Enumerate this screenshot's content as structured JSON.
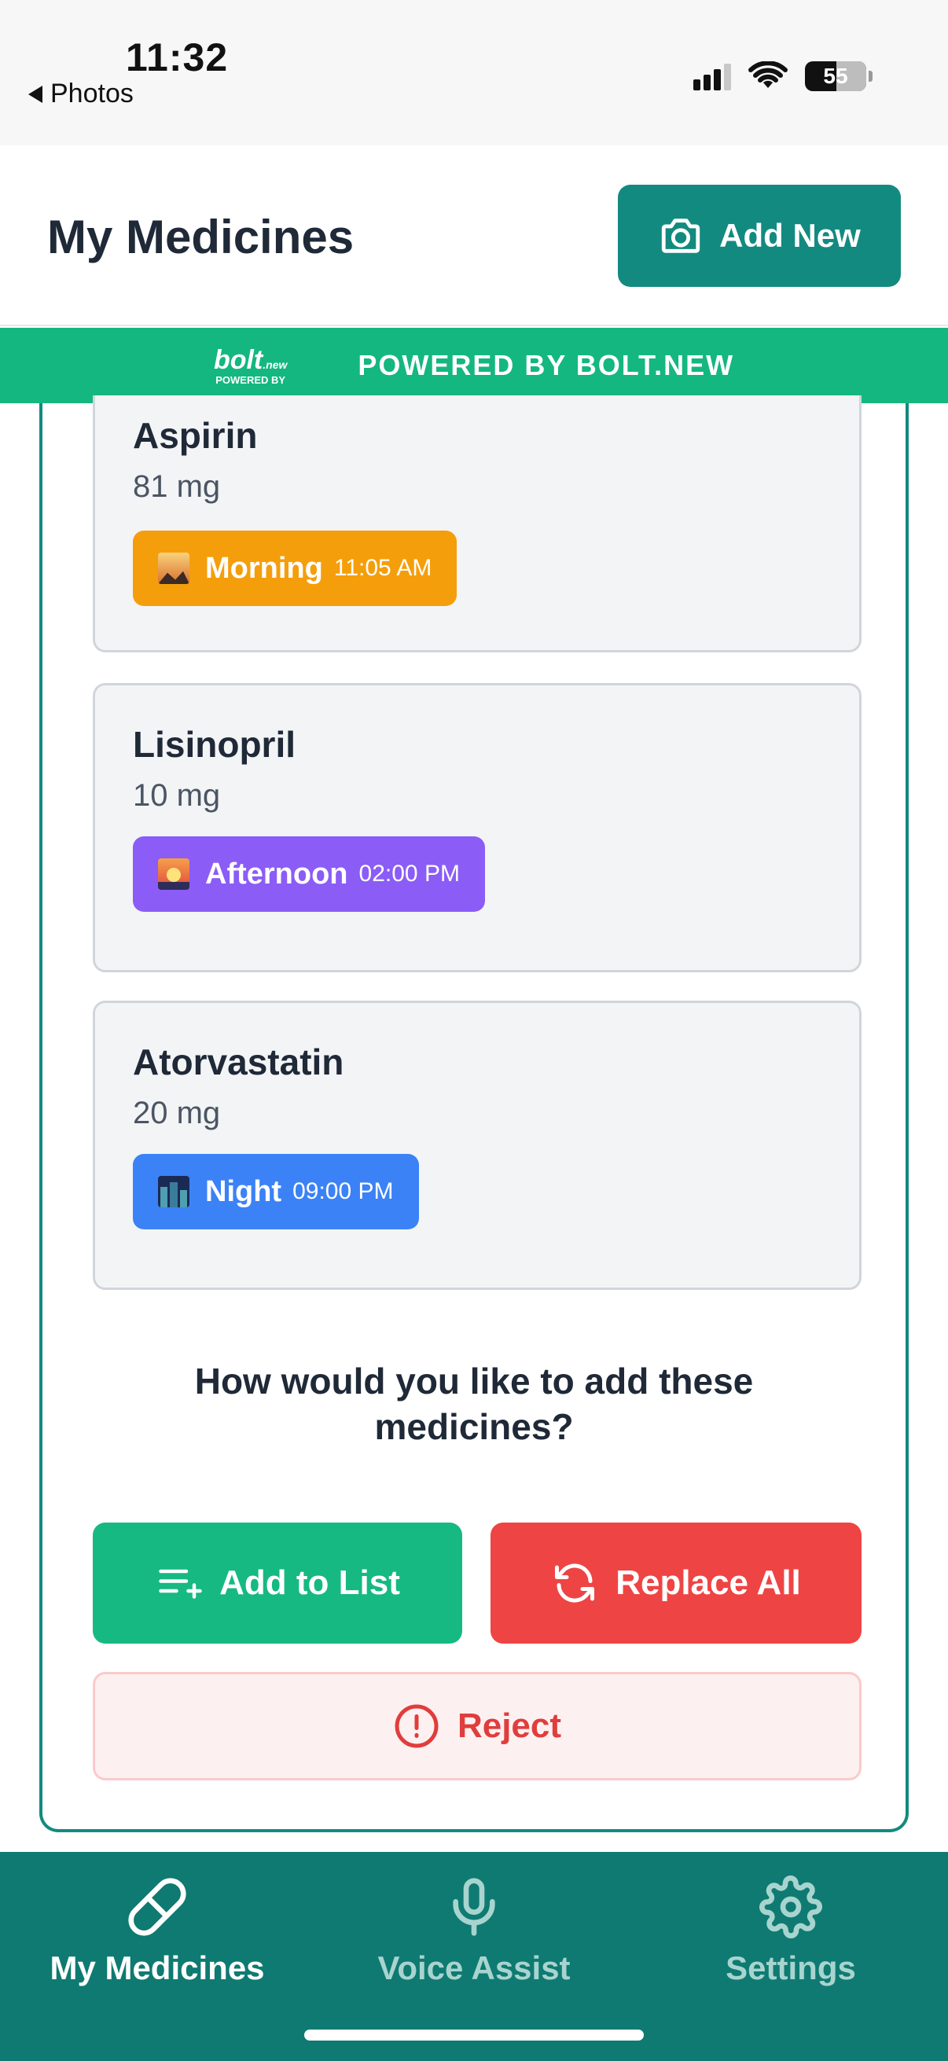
{
  "status_bar": {
    "time": "11:32",
    "back_label": "Photos",
    "battery": "55"
  },
  "header": {
    "title": "My Medicines",
    "add_button": "Add New"
  },
  "banner": {
    "logo_main": "bolt",
    "logo_suffix": ".new",
    "logo_sub": "POWERED BY",
    "text": "POWERED BY BOLT.NEW"
  },
  "medicines": [
    {
      "name": "Aspirin",
      "dose": "81 mg",
      "period": "Morning",
      "time": "11:05 AM",
      "color": "#f59e0b"
    },
    {
      "name": "Lisinopril",
      "dose": "10 mg",
      "period": "Afternoon",
      "time": "02:00 PM",
      "color": "#8b5cf6"
    },
    {
      "name": "Atorvastatin",
      "dose": "20 mg",
      "period": "Night",
      "time": "09:00 PM",
      "color": "#3b82f6"
    }
  ],
  "question": {
    "line1": "How would you like to add these",
    "line2": "medicines?"
  },
  "actions": {
    "add_to_list": "Add to List",
    "replace_all": "Replace All",
    "reject": "Reject"
  },
  "nav": {
    "items": [
      {
        "label": "My Medicines",
        "icon": "pill-icon",
        "active": true
      },
      {
        "label": "Voice Assist",
        "icon": "microphone-icon",
        "active": false
      },
      {
        "label": "Settings",
        "icon": "gear-icon",
        "active": false
      }
    ]
  },
  "colors": {
    "teal": "#138a80",
    "green": "#16b982",
    "red": "#ef4444",
    "nav_bg": "#0f7a72"
  }
}
